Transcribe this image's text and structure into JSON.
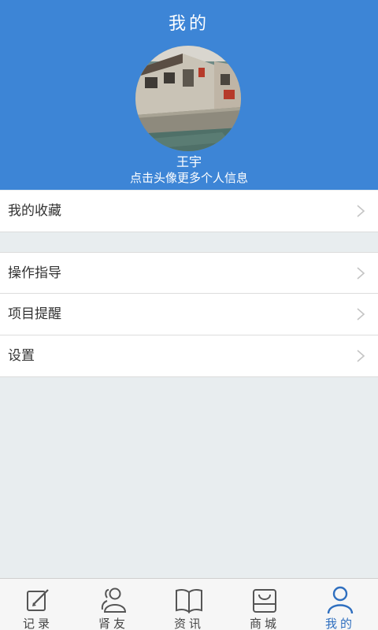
{
  "header": {
    "title": "我的"
  },
  "profile": {
    "name": "王宇",
    "hint": "点击头像更多个人信息"
  },
  "menu": {
    "favorites": "我的收藏",
    "guide": "操作指导",
    "reminder": "项目提醒",
    "settings": "设置"
  },
  "tabbar": {
    "items": [
      {
        "label": "记录",
        "icon": "pencil-note-icon"
      },
      {
        "label": "肾友",
        "icon": "people-icon"
      },
      {
        "label": "资讯",
        "icon": "book-icon"
      },
      {
        "label": "商城",
        "icon": "shopping-bag-icon"
      },
      {
        "label": "我的",
        "icon": "person-icon",
        "active": true
      }
    ]
  },
  "colors": {
    "accent": "#3d85d6",
    "active_tab": "#2f6fbf",
    "background": "#e8edef"
  }
}
